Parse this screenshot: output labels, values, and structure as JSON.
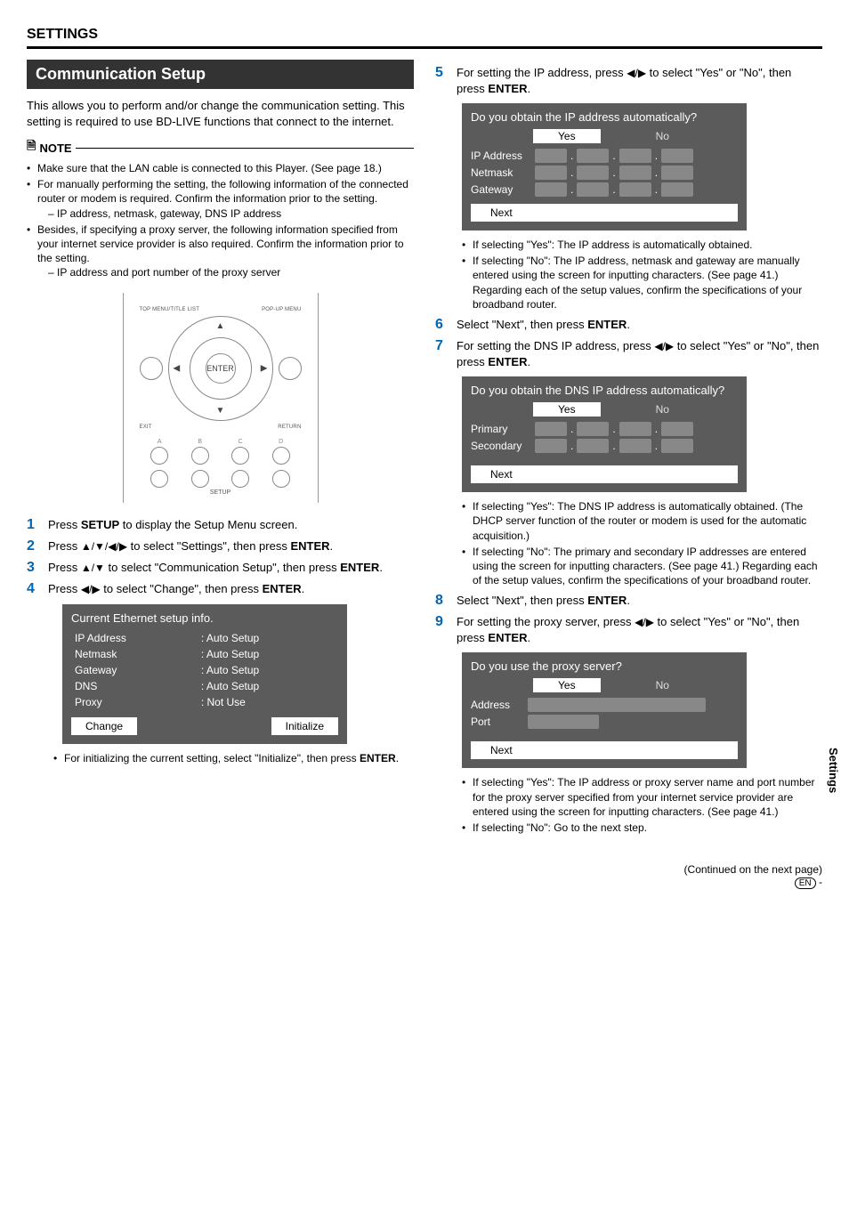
{
  "section_header": "SETTINGS",
  "subsection_title": "Communication Setup",
  "intro": "This allows you to perform and/or change the communication setting. This setting is required to use BD-LIVE functions that connect to the internet.",
  "note_label": "NOTE",
  "notes": {
    "n1": "Make sure that the LAN cable is connected to this Player. (See page 18.)",
    "n2": "For manually performing the setting, the following information of the connected router or modem is required. Confirm the information prior to the setting.",
    "n2_sub": "IP address, netmask, gateway, DNS IP address",
    "n3": "Besides, if specifying a proxy server, the following information specified from your internet service provider is also required. Confirm the information prior to the setting.",
    "n3_sub": "IP address and port number of the proxy server"
  },
  "remote": {
    "top_menu": "TOP MENU/TITLE LIST",
    "popup": "POP-UP MENU",
    "enter": "ENTER",
    "exit": "EXIT",
    "return": "RETURN",
    "a": "A",
    "b": "B",
    "c": "C",
    "d": "D",
    "setup": "SETUP"
  },
  "steps_left": {
    "s1_num": "1",
    "s1": "Press SETUP to display the Setup Menu screen.",
    "s2_num": "2",
    "s2": "Press ▲/▼/◀/▶ to select \"Settings\", then press ENTER.",
    "s3_num": "3",
    "s3": "Press ▲/▼ to select \"Communication Setup\", then press ENTER.",
    "s4_num": "4",
    "s4": "Press ◀/▶ to select \"Change\", then press ENTER."
  },
  "ethernet_panel": {
    "title": "Current Ethernet setup info.",
    "rows": {
      "ip_k": "IP Address",
      "ip_v": ": Auto Setup",
      "nm_k": "Netmask",
      "nm_v": ": Auto Setup",
      "gw_k": "Gateway",
      "gw_v": ": Auto Setup",
      "dns_k": "DNS",
      "dns_v": ": Auto Setup",
      "px_k": "Proxy",
      "px_v": ": Not Use"
    },
    "change_btn": "Change",
    "init_btn": "Initialize"
  },
  "left_tail": "For initializing the current setting, select \"Initialize\", then press ENTER.",
  "steps_right": {
    "s5_num": "5",
    "s5": "For setting the IP address, press ◀/▶ to select \"Yes\" or \"No\", then press ENTER.",
    "s6_num": "6",
    "s6": "Select \"Next\", then press ENTER.",
    "s7_num": "7",
    "s7": "For setting the DNS IP address, press ◀/▶ to select \"Yes\" or \"No\", then press ENTER.",
    "s8_num": "8",
    "s8": "Select \"Next\", then press ENTER.",
    "s9_num": "9",
    "s9": "For setting the proxy server, press ◀/▶ to select \"Yes\" or \"No\", then press ENTER."
  },
  "ip_panel": {
    "q": "Do you obtain the IP address automatically?",
    "yes": "Yes",
    "no": "No",
    "ip": "IP Address",
    "nm": "Netmask",
    "gw": "Gateway",
    "next": "Next"
  },
  "ip_notes": {
    "yes": "If selecting \"Yes\": The IP address is automatically obtained.",
    "no": "If selecting \"No\": The IP address, netmask and gateway are manually entered using the screen for inputting characters. (See page 41.) Regarding each of the setup values, confirm the specifications of your broadband router."
  },
  "dns_panel": {
    "q": "Do you obtain the DNS IP address automatically?",
    "yes": "Yes",
    "no": "No",
    "primary": "Primary",
    "secondary": "Secondary",
    "next": "Next"
  },
  "dns_notes": {
    "yes": "If selecting \"Yes\": The DNS IP address is automatically obtained. (The DHCP server function of the router or modem is used for the automatic acquisition.)",
    "no": "If selecting \"No\": The primary and secondary IP addresses are entered using the screen for inputting characters. (See page 41.) Regarding each of the setup values, confirm the specifications of your broadband router."
  },
  "proxy_panel": {
    "q": "Do you use the proxy server?",
    "yes": "Yes",
    "no": "No",
    "address": "Address",
    "port": "Port",
    "next": "Next"
  },
  "proxy_notes": {
    "yes": "If selecting \"Yes\": The IP address or proxy server name and port number for the proxy server specified from your internet service provider are entered using the screen for inputting characters. (See page 41.)",
    "no": "If selecting \"No\": Go to the next step."
  },
  "side_tab": "Settings",
  "continued": "(Continued on the next page)",
  "lang_badge": "EN",
  "dash": "-"
}
